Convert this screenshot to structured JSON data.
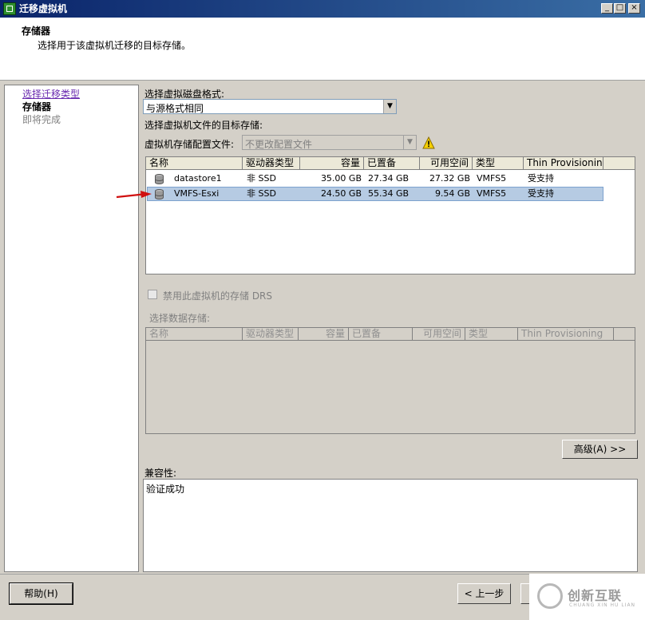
{
  "window": {
    "title": "迁移虚拟机",
    "minimize": "_",
    "maximize": "□",
    "close": "×"
  },
  "header": {
    "title": "存储器",
    "description": "选择用于该虚拟机迁移的目标存储。"
  },
  "steps": [
    {
      "label": "选择迁移类型",
      "state": "link"
    },
    {
      "label": "存储器",
      "state": "current"
    },
    {
      "label": "即将完成",
      "state": "future"
    }
  ],
  "disk_format": {
    "label": "选择虚拟磁盘格式:",
    "value": "与源格式相同"
  },
  "target_storage_label": "选择虚拟机文件的目标存储:",
  "storage_profile": {
    "label": "虚拟机存储配置文件:",
    "value": "不更改配置文件"
  },
  "datastore_table": {
    "columns": [
      "名称",
      "驱动器类型",
      "容量",
      "已置备",
      "可用空间",
      "类型",
      "Thin Provisioning"
    ],
    "rows": [
      {
        "name": "datastore1",
        "drive": "非 SSD",
        "capacity": "35.00 GB",
        "provisioned": "27.34 GB",
        "free": "27.32 GB",
        "type": "VMFS5",
        "thin": "受支持",
        "selected": false
      },
      {
        "name": "VMFS-Esxi",
        "drive": "非 SSD",
        "capacity": "24.50 GB",
        "provisioned": "55.34 GB",
        "free": "9.54 GB",
        "type": "VMFS5",
        "thin": "受支持",
        "selected": true
      }
    ]
  },
  "disable_drs": {
    "label": "禁用此虚拟机的存储 DRS",
    "checked": false
  },
  "select_datastore": {
    "label": "选择数据存储:",
    "columns": [
      "名称",
      "驱动器类型",
      "容量",
      "已置备",
      "可用空间",
      "类型",
      "Thin Provisioning"
    ]
  },
  "advanced_button": "高级(A) >>",
  "compatibility": {
    "label": "兼容性:",
    "value": "验证成功"
  },
  "footer": {
    "help": "帮助(H)",
    "back": "< 上一步"
  },
  "watermark": {
    "text": "创新互联",
    "sub": "CHUANG XIN HU LIAN"
  },
  "colors": {
    "selection": "#b6cbe3",
    "title_bar": "#0a246a",
    "link": "#6a2bb0",
    "arrow": "#d01010"
  }
}
